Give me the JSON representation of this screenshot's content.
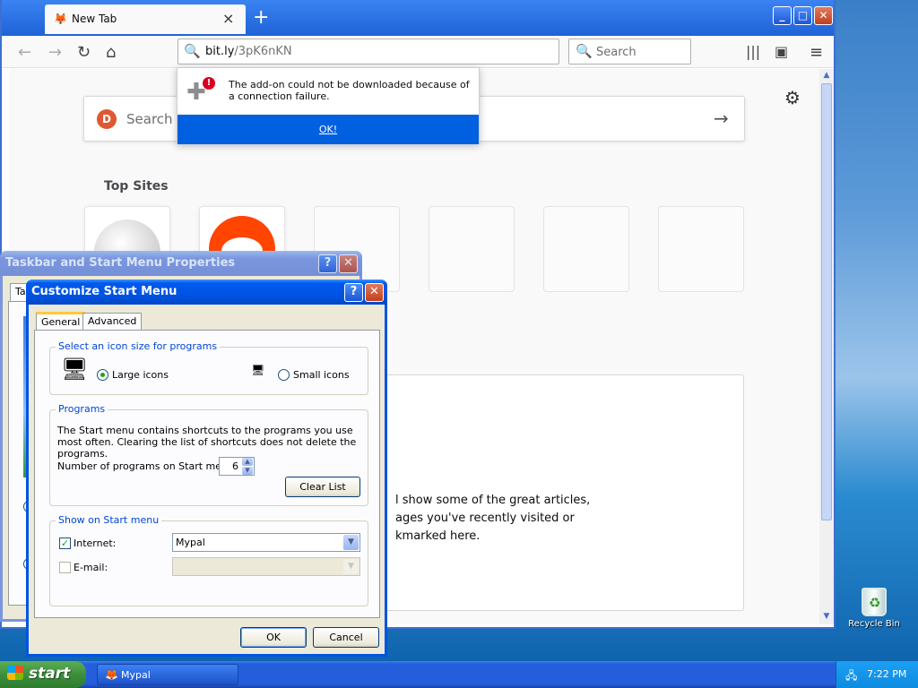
{
  "desktop": {
    "recycle_label": "Recycle Bin"
  },
  "firefox": {
    "tab_title": "New Tab",
    "url_domain": "bit.ly",
    "url_path": "/3pK6nKN",
    "search_placeholder": "Search",
    "content": {
      "search_placeholder": "Search th",
      "top_sites_title": "Top Sites",
      "highlights_lines": [
        "l show some of the great articles,",
        "ages you've recently visited or",
        "kmarked here."
      ]
    },
    "doorhanger": {
      "message": "The add-on could not be downloaded because of a connection failure.",
      "ok_label": "OK!"
    }
  },
  "taskbar_props": {
    "title": "Taskbar and Start Menu Properties",
    "tab_fragment": "Ta"
  },
  "customize": {
    "title": "Customize Start Menu",
    "tabs": [
      "General",
      "Advanced"
    ],
    "icon_size": {
      "legend": "Select an icon size for programs",
      "large": "Large icons",
      "small": "Small icons",
      "selected": "Large icons"
    },
    "programs": {
      "legend": "Programs",
      "description": "The Start menu contains shortcuts to the programs you use most often. Clearing the list of shortcuts does not delete the programs.",
      "count_label": "Number of programs on Start menu:",
      "count_value": "6",
      "clear_label": "Clear List"
    },
    "show_on_start": {
      "legend": "Show on Start menu",
      "internet_label": "Internet:",
      "internet_checked": true,
      "internet_value": "Mypal",
      "email_label": "E-mail:",
      "email_checked": false,
      "email_value": ""
    },
    "ok_label": "OK",
    "cancel_label": "Cancel"
  },
  "taskbar": {
    "start_label": "start",
    "items": [
      {
        "label": "Mypal"
      }
    ],
    "clock": "7:22 PM"
  }
}
